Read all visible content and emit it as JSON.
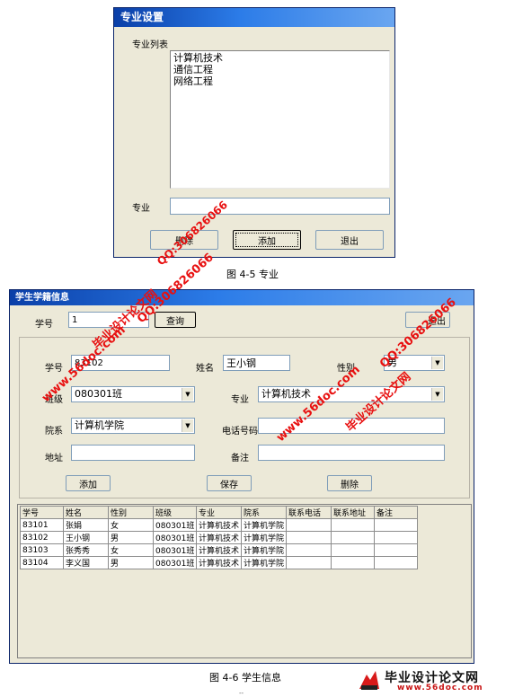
{
  "major_dialog": {
    "title": "专业设置",
    "list_label": "专业列表",
    "list_items": [
      "计算机技术",
      "通信工程",
      "网络工程"
    ],
    "major_label": "专业",
    "major_value": "",
    "delete_label": "删除",
    "add_label": "添加",
    "exit_label": "退出"
  },
  "caption_1": "图 4-5 专业",
  "student_window": {
    "title": "学生学籍信息",
    "query": {
      "id_label": "学号",
      "id_value": "1",
      "query_button": "查询",
      "exit_button": "退出"
    },
    "form": {
      "id_label": "学号",
      "id_value": "83102",
      "name_label": "姓名",
      "name_value": "王小钢",
      "gender_label": "性别",
      "gender_value": "男",
      "class_label": "班级",
      "class_value": "080301班",
      "major_label": "专业",
      "major_value": "计算机技术",
      "dept_label": "院系",
      "dept_value": "计算机学院",
      "phone_label": "电话号码",
      "phone_value": "",
      "address_label": "地址",
      "address_value": "",
      "note_label": "备注",
      "note_value": ""
    },
    "buttons": {
      "add": "添加",
      "save": "保存",
      "delete": "删除"
    },
    "table": {
      "columns": [
        "学号",
        "姓名",
        "性别",
        "班级",
        "专业",
        "院系",
        "联系电话",
        "联系地址",
        "备注"
      ],
      "rows": [
        [
          "83101",
          "张娟",
          "女",
          "080301班",
          "计算机技术",
          "计算机学院",
          "",
          "",
          ""
        ],
        [
          "83102",
          "王小钢",
          "男",
          "080301班",
          "计算机技术",
          "计算机学院",
          "",
          "",
          ""
        ],
        [
          "83103",
          "张秀秀",
          "女",
          "080301班",
          "计算机技术",
          "计算机学院",
          "",
          "",
          ""
        ],
        [
          "83104",
          "李义国",
          "男",
          "080301班",
          "计算机技术",
          "计算机学院",
          "",
          "",
          ""
        ]
      ]
    }
  },
  "caption_2": "图 4-6 学生信息",
  "watermarks": {
    "site_cn": "毕业设计论文网",
    "site_url": "www.56doc.com",
    "qq": "QQ:306826066",
    "logo_url": "www.56doc.com"
  },
  "page_number": "--"
}
